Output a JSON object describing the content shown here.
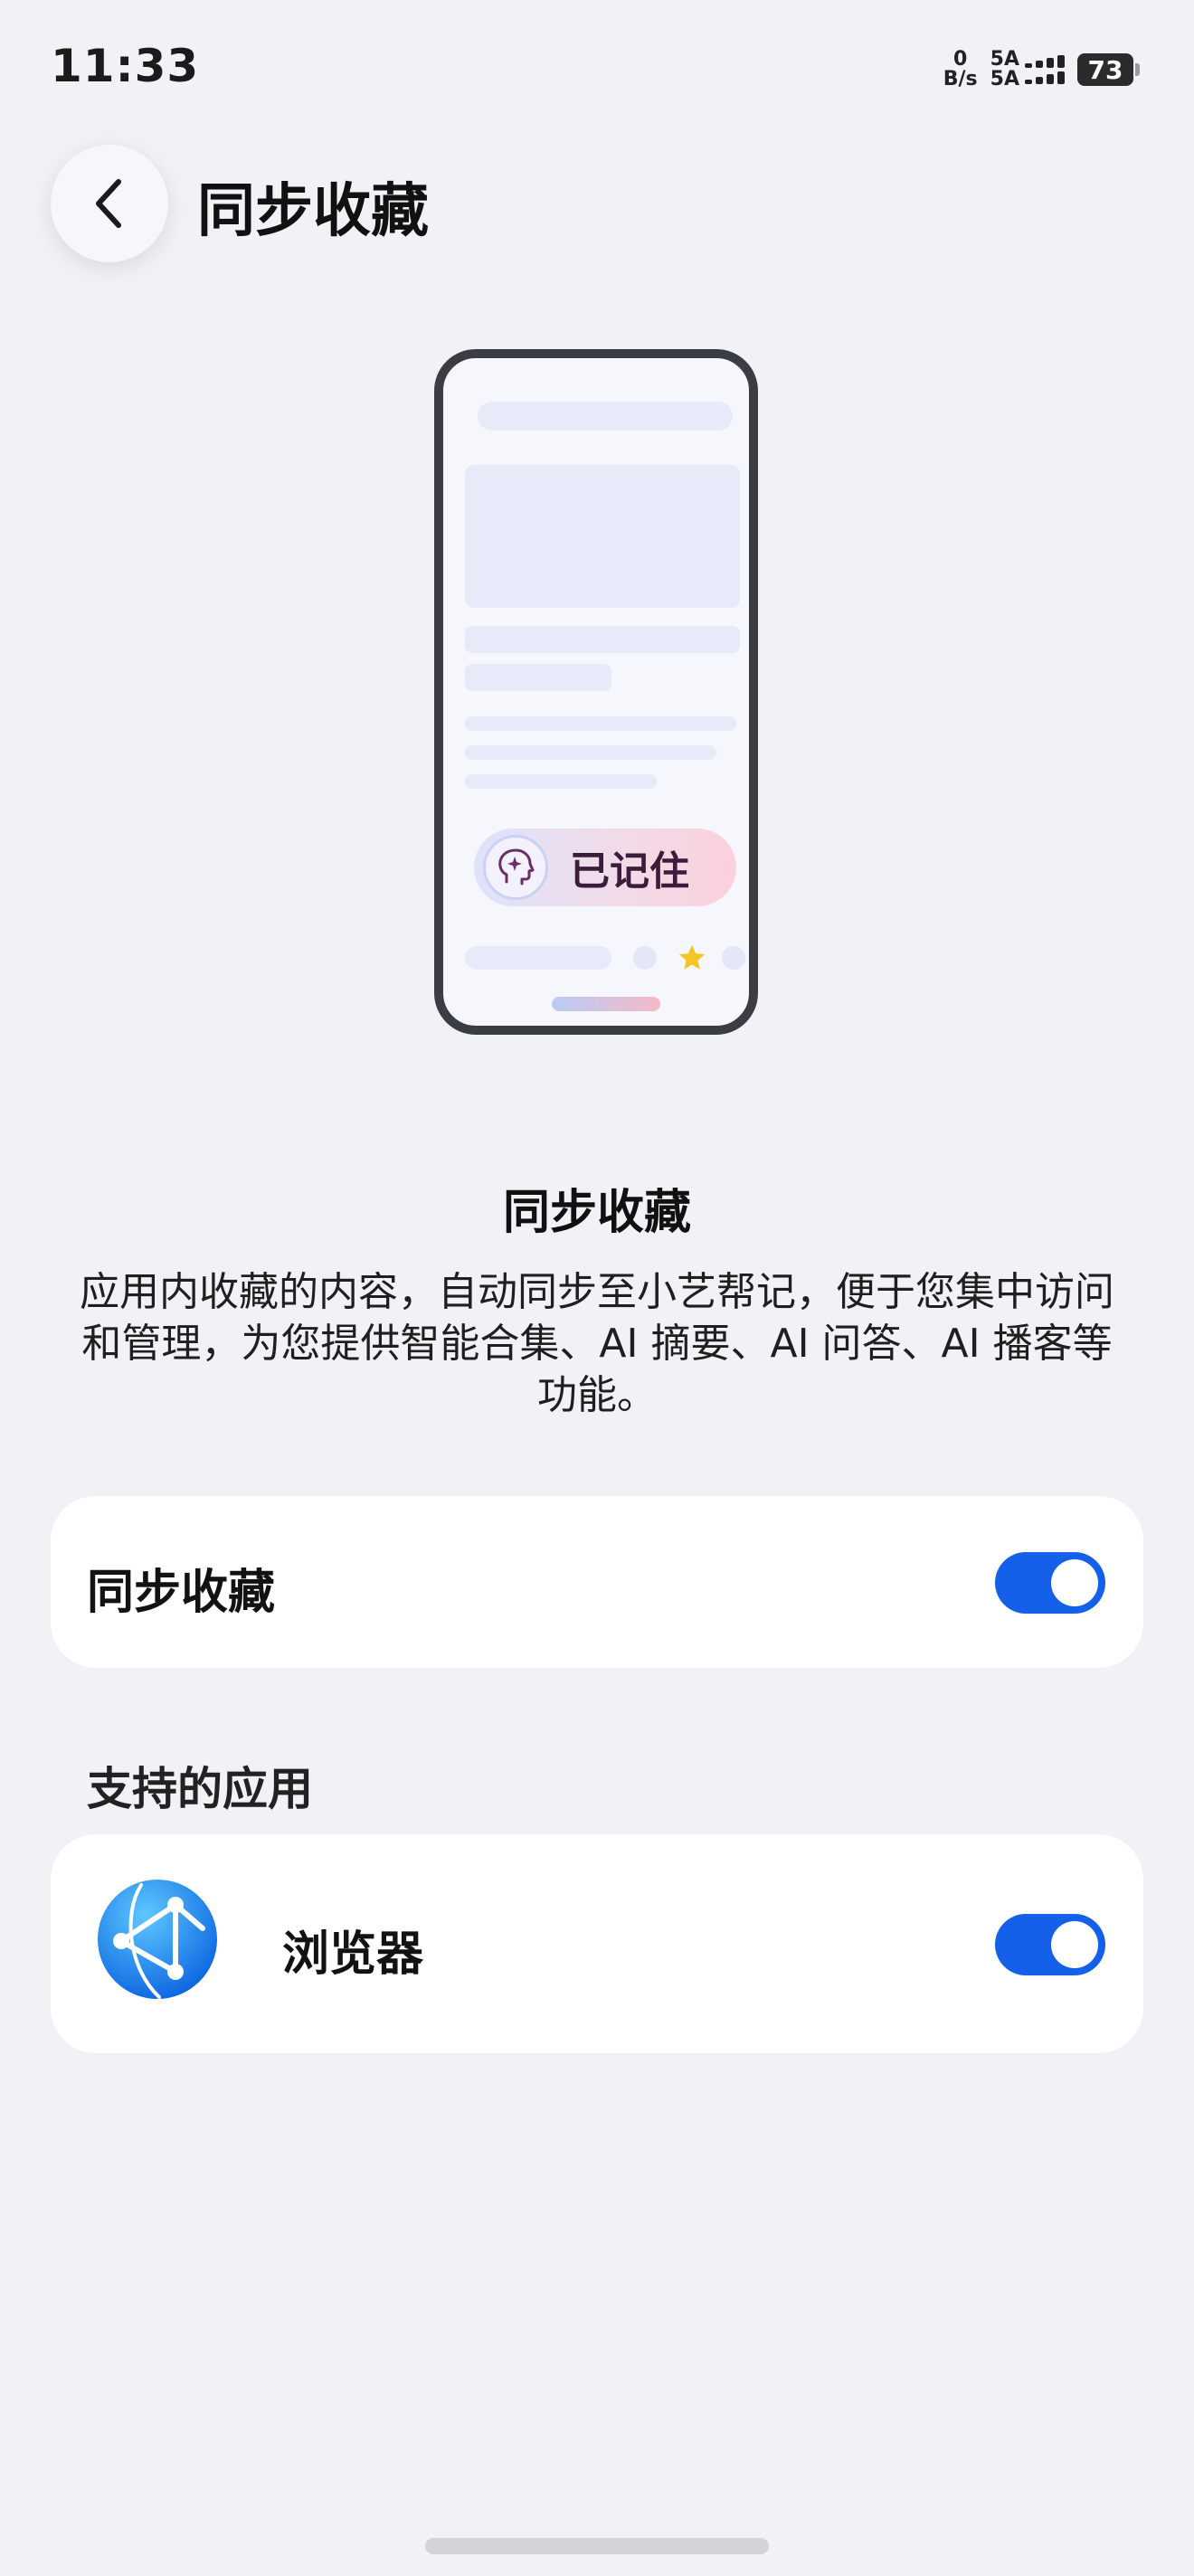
{
  "status_bar": {
    "time": "11:33",
    "net_speed_value": "0",
    "net_speed_unit": "B/s",
    "signal_label_1": "5A",
    "signal_label_2": "5A",
    "battery": "73"
  },
  "header": {
    "title": "同步收藏",
    "back_icon": "chevron-left-icon"
  },
  "illustration": {
    "badge_text": "已记住",
    "badge_icon": "ai-brain-icon",
    "star_icon": "star-icon"
  },
  "feature": {
    "title": "同步收藏",
    "description": "应用内收藏的内容，自动同步至小艺帮记，便于您集中访问和管理，为您提供智能合集、AI 摘要、AI 问答、AI 播客等功能。"
  },
  "sync_setting": {
    "label": "同步收藏",
    "enabled": true
  },
  "supported_apps": {
    "heading": "支持的应用",
    "items": [
      {
        "name": "浏览器",
        "icon": "browser-icon",
        "enabled": true
      }
    ]
  },
  "colors": {
    "background": "#f1f2f6",
    "toggle_on": "#1560e8",
    "card": "#ffffff"
  }
}
